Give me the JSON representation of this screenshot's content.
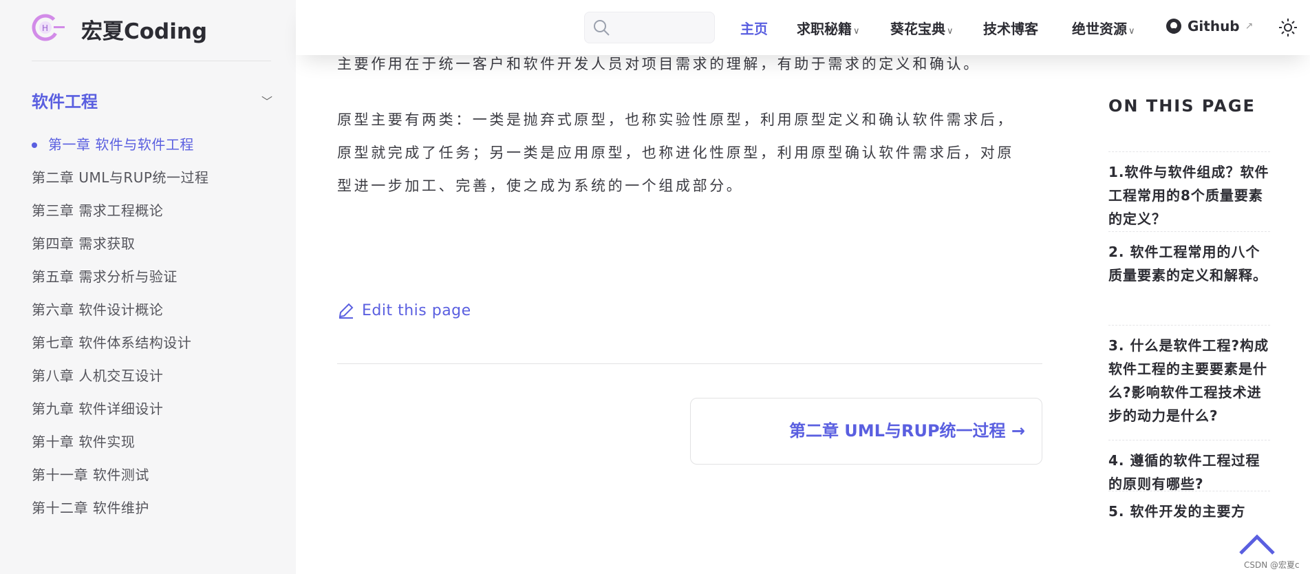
{
  "brand": {
    "name": "宏夏Coding",
    "logo_letter": "H"
  },
  "header": {
    "search_placeholder": "",
    "nav": [
      {
        "label": "主页",
        "active": true,
        "dropdown": false
      },
      {
        "label": "求职秘籍",
        "dropdown": true
      },
      {
        "label": "葵花宝典",
        "dropdown": true
      },
      {
        "label": "技术博客",
        "dropdown": false
      },
      {
        "label": "绝世资源",
        "dropdown": true
      }
    ],
    "github": "Github",
    "accent": "#5a5fe0"
  },
  "sidebar": {
    "group": "软件工程",
    "items": [
      "第一章 软件与软件工程",
      "第二章 UML与RUP统一过程",
      "第三章 需求工程概论",
      "第四章 需求获取",
      "第五章 需求分析与验证",
      "第六章 软件设计概论",
      "第七章 软件体系结构设计",
      "第八章 人机交互设计",
      "第九章 软件详细设计",
      "第十章 软件实现",
      "第十一章 软件测试",
      "第十二章 软件维护"
    ],
    "active_index": 0
  },
  "content": {
    "lines": [
      "主要作用在于统一客户和软件开发人员对项目需求的理解，有助于需求的定义和确认。",
      "原型主要有两类：一类是抛弃式原型，也称实验性原型，利用原型定义和确认软件需求后，",
      "原型就完成了任务；另一类是应用原型，也称进化性原型，利用原型确认软件需求后，对原",
      "型进一步加工、完善，使之成为系统的一个组成部分。"
    ],
    "edit_link": "Edit this page",
    "next_link": "第二章 UML与RUP统一过程 →"
  },
  "toc": {
    "title": "ON THIS PAGE",
    "items": [
      "1.软件与软件组成？软件工程常用的8个质量要素的定义？",
      "2. 软件工程常用的八个质量要素的定义和解释。",
      "3. 什么是软件工程?构成软件工程的主要要素是什么?影响软件工程技术进步的动力是什么?",
      "4. 遵循的软件工程过程的原则有哪些?",
      "5. 软件开发的主要方"
    ]
  },
  "watermark": "CSDN @宏夏c"
}
